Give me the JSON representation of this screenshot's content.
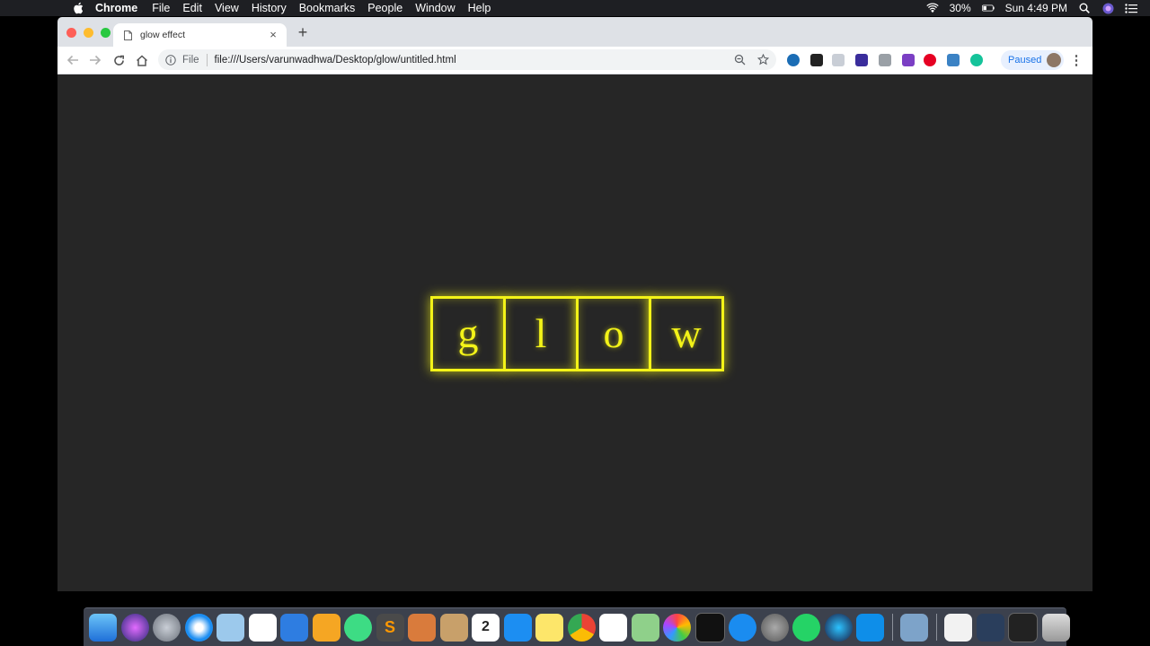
{
  "menubar": {
    "app_name": "Chrome",
    "menus": [
      "File",
      "Edit",
      "View",
      "History",
      "Bookmarks",
      "People",
      "Window",
      "Help"
    ],
    "battery": "30%",
    "clock": "Sun 4:49 PM"
  },
  "browser": {
    "tab": {
      "title": "glow effect",
      "close": "×"
    },
    "new_tab": "+",
    "address": {
      "scheme": "File",
      "url": "file:///Users/varunwadhwa/Desktop/glow/untitled.html"
    },
    "profile_label": "Paused",
    "menu_glyph": "⋮"
  },
  "page": {
    "glow_letters": [
      "g",
      "l",
      "o",
      "w"
    ],
    "glow_color": "#f3f318",
    "background": "#262626"
  },
  "dock": {
    "calendar_day": "2",
    "apps": [
      "finder-icon",
      "siri-icon",
      "launchpad-icon",
      "safari-icon",
      "preview-icon",
      "numbers-icon",
      "keynote-icon",
      "pages-icon",
      "android-studio-icon",
      "sublime-text-icon",
      "photo-app-icon",
      "notebook-icon",
      "calendar-icon",
      "xcode-icon",
      "notes-icon",
      "chrome-icon",
      "reminders-icon",
      "maps-icon",
      "photos-icon",
      "terminal-icon",
      "app-store-icon",
      "system-preferences-icon",
      "whatsapp-icon",
      "webstorm-icon",
      "teamviewer-icon",
      "screen-capture-icon",
      "document-icon",
      "desktop-icon",
      "console-icon",
      "trash-icon"
    ]
  }
}
